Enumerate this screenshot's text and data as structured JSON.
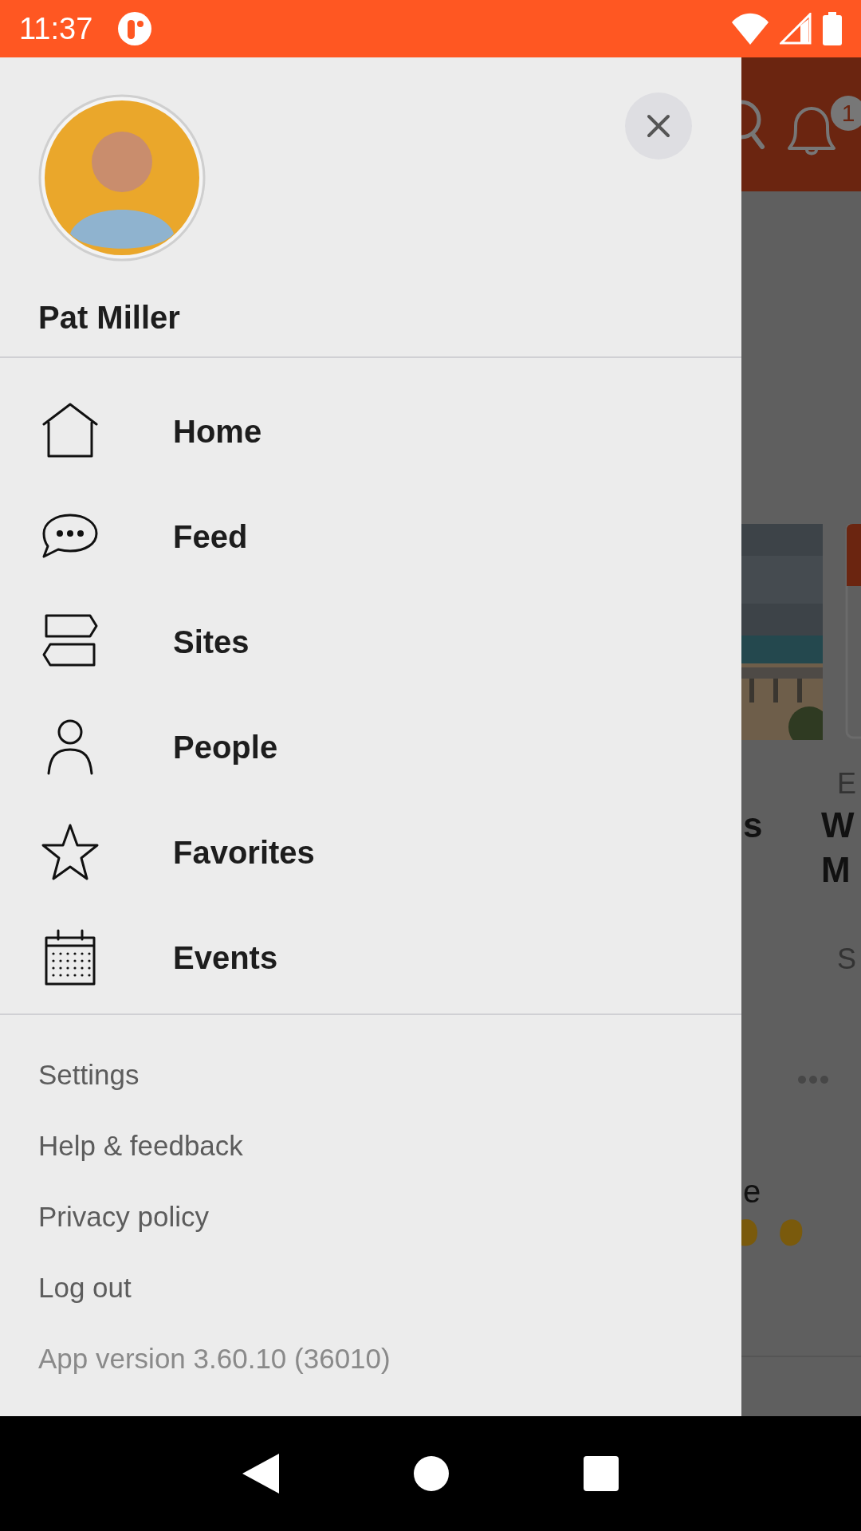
{
  "status_bar": {
    "time": "11:37"
  },
  "drawer": {
    "profile": {
      "name": "Pat Miller"
    },
    "menu": [
      {
        "label": "Home",
        "kind": "home"
      },
      {
        "label": "Feed",
        "kind": "chat"
      },
      {
        "label": "Sites",
        "kind": "signpost"
      },
      {
        "label": "People",
        "kind": "person"
      },
      {
        "label": "Favorites",
        "kind": "star"
      },
      {
        "label": "Events",
        "kind": "calendar"
      }
    ],
    "footer_links": [
      "Settings",
      "Help & feedback",
      "Privacy policy",
      "Log out"
    ],
    "version": "App version 3.60.10 (36010)"
  },
  "background": {
    "notification_badge": "1",
    "card_title_end": "s",
    "card_text_end": "e",
    "side_card": {
      "eyebrow": "E",
      "title_lines": [
        "W",
        "M"
      ],
      "subtitle": "S"
    }
  }
}
